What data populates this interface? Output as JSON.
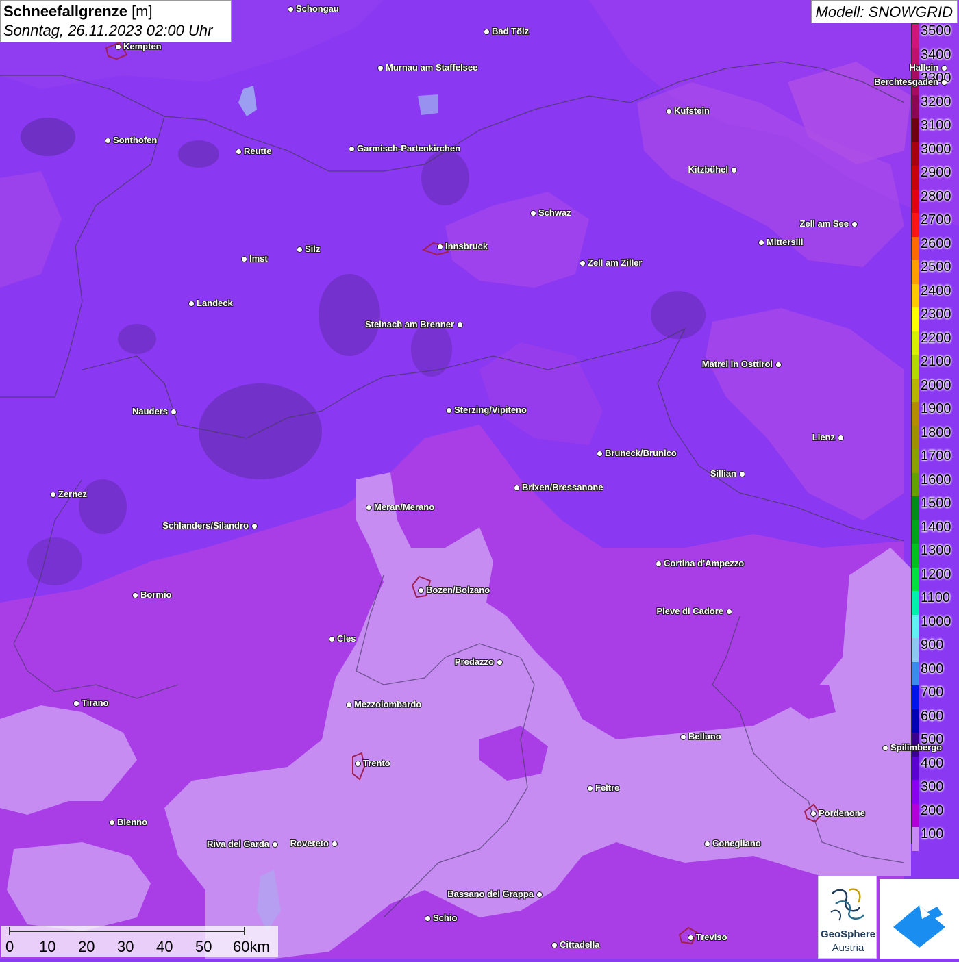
{
  "title": {
    "bold": "Schneefallgrenze",
    "unit": " [m]",
    "datetime": "Sonntag, 26.11.2023 02:00 Uhr"
  },
  "model": "Modell: SNOWGRID",
  "legend": {
    "labels": [
      "3500",
      "3400",
      "3300",
      "3200",
      "3100",
      "3000",
      "2900",
      "2800",
      "2700",
      "2600",
      "2500",
      "2400",
      "2300",
      "2200",
      "2100",
      "2000",
      "1900",
      "1800",
      "1700",
      "1600",
      "1500",
      "1400",
      "1300",
      "1200",
      "1100",
      "1000",
      "900",
      "800",
      "700",
      "600",
      "500",
      "400",
      "300",
      "200",
      "100"
    ],
    "colors": [
      "#d0157a",
      "#c0106e",
      "#a80b62",
      "#8c0656",
      "#6e0010",
      "#a80010",
      "#c8000c",
      "#e00010",
      "#ff1414",
      "#ff6a00",
      "#ff9e00",
      "#ffc800",
      "#ffff00",
      "#d8f000",
      "#b4d800",
      "#b8b400",
      "#b48c00",
      "#a09000",
      "#8ca000",
      "#64a000",
      "#008c18",
      "#00a41a",
      "#00c020",
      "#00e040",
      "#00f0b0",
      "#60f0f0",
      "#8cc8f0",
      "#3c8cf0",
      "#0014f0",
      "#0000b4",
      "#3c0090",
      "#5a00d0",
      "#8a00f0",
      "#b400d8",
      "#c88cf0"
    ]
  },
  "cities": [
    {
      "name": "Schongau"
    },
    {
      "name": "Bad Tölz"
    },
    {
      "name": "Kempten"
    },
    {
      "name": "Murnau am Staffelsee"
    },
    {
      "name": "Hallein"
    },
    {
      "name": "Berchtesgaden"
    },
    {
      "name": "Kufstein"
    },
    {
      "name": "Sonthofen"
    },
    {
      "name": "Reutte"
    },
    {
      "name": "Garmisch-Partenkirchen"
    },
    {
      "name": "Kitzbühel"
    },
    {
      "name": "Schwaz"
    },
    {
      "name": "Zell am See"
    },
    {
      "name": "Innsbruck"
    },
    {
      "name": "Mittersill"
    },
    {
      "name": "Imst"
    },
    {
      "name": "Silz"
    },
    {
      "name": "Zell am Ziller"
    },
    {
      "name": "Landeck"
    },
    {
      "name": "Steinach am Brenner"
    },
    {
      "name": "Matrei in Osttirol"
    },
    {
      "name": "Nauders"
    },
    {
      "name": "Sterzing/Vipiteno"
    },
    {
      "name": "Lienz"
    },
    {
      "name": "Bruneck/Brunico"
    },
    {
      "name": "Sillian"
    },
    {
      "name": "Brixen/Bressanone"
    },
    {
      "name": "Zernez"
    },
    {
      "name": "Meran/Merano"
    },
    {
      "name": "Schlanders/Silandro"
    },
    {
      "name": "Cortina d'Ampezzo"
    },
    {
      "name": "Bozen/Bolzano"
    },
    {
      "name": "Bormio"
    },
    {
      "name": "Pieve di Cadore"
    },
    {
      "name": "Cles"
    },
    {
      "name": "Predazzo"
    },
    {
      "name": "Tirano"
    },
    {
      "name": "Mezzolombardo"
    },
    {
      "name": "Belluno"
    },
    {
      "name": "Spilimbergo"
    },
    {
      "name": "Trento"
    },
    {
      "name": "Feltre"
    },
    {
      "name": "Pordenone"
    },
    {
      "name": "Bienno"
    },
    {
      "name": "Riva del Garda"
    },
    {
      "name": "Rovereto"
    },
    {
      "name": "Conegliano"
    },
    {
      "name": "Bassano del Grappa"
    },
    {
      "name": "Schio"
    },
    {
      "name": "Cittadella"
    },
    {
      "name": "Treviso"
    }
  ],
  "scale": {
    "ticks": [
      "0",
      "10",
      "20",
      "30",
      "40",
      "50",
      "60km"
    ]
  },
  "logo": {
    "line1": "GeoSphere",
    "line2": "Austria"
  }
}
